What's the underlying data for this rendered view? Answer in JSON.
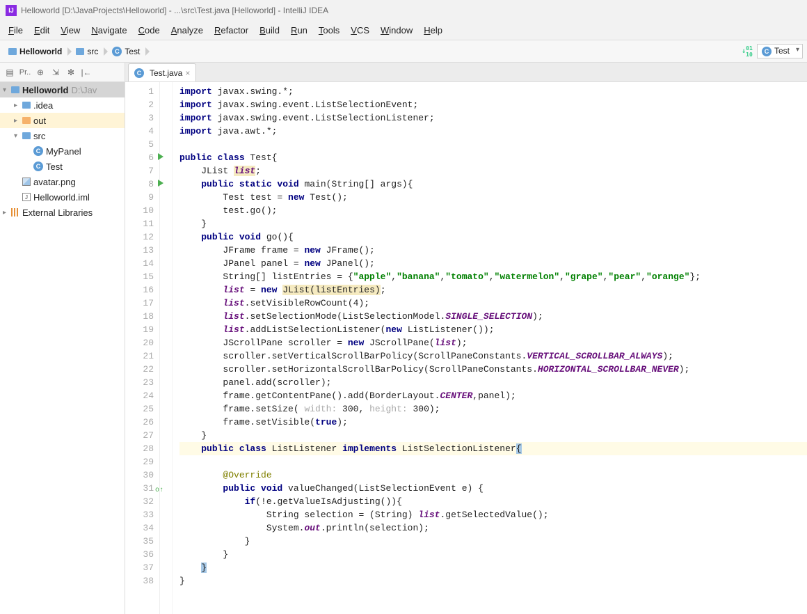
{
  "title": "Helloworld [D:\\JavaProjects\\Helloworld] - ...\\src\\Test.java [Helloworld] - IntelliJ IDEA",
  "menu": [
    "File",
    "Edit",
    "View",
    "Navigate",
    "Code",
    "Analyze",
    "Refactor",
    "Build",
    "Run",
    "Tools",
    "VCS",
    "Window",
    "Help"
  ],
  "breadcrumb": [
    {
      "icon": "folder",
      "label": "Helloworld",
      "bold": true
    },
    {
      "icon": "folder",
      "label": "src"
    },
    {
      "icon": "class",
      "label": "Test"
    }
  ],
  "run_config": "Test",
  "tab": {
    "label": "Test.java"
  },
  "tree": {
    "root": {
      "label": "Helloworld",
      "path": "D:\\JavaProjects\\Helloworld"
    },
    "children": [
      {
        "icon": "folder",
        "label": ".idea",
        "expandable": true
      },
      {
        "icon": "folder-orange",
        "label": "out",
        "expandable": true,
        "hl": true
      },
      {
        "icon": "folder",
        "label": "src",
        "expanded": true,
        "children": [
          {
            "icon": "class",
            "label": "MyPanel"
          },
          {
            "icon": "class",
            "label": "Test"
          }
        ]
      },
      {
        "icon": "image",
        "label": "avatar.png"
      },
      {
        "icon": "iml",
        "label": "Helloworld.iml"
      }
    ],
    "external": "External Libraries"
  },
  "code": {
    "lines": [
      {
        "n": 1,
        "html": "<span class='kw'>import</span> javax.swing.*;"
      },
      {
        "n": 2,
        "html": "<span class='kw'>import</span> javax.swing.event.ListSelectionEvent;"
      },
      {
        "n": 3,
        "html": "<span class='kw'>import</span> javax.swing.event.ListSelectionListener;"
      },
      {
        "n": 4,
        "html": "<span class='kw'>import</span> java.awt.*;"
      },
      {
        "n": 5,
        "html": ""
      },
      {
        "n": 6,
        "run": true,
        "html": "<span class='kw'>public class</span> Test{"
      },
      {
        "n": 7,
        "html": "    JList <span class='fld warn-bg'>list</span>;"
      },
      {
        "n": 8,
        "run": true,
        "html": "    <span class='kw'>public static void</span> main(String[] args){"
      },
      {
        "n": 9,
        "html": "        Test test = <span class='kw'>new</span> Test();"
      },
      {
        "n": 10,
        "html": "        test.go();"
      },
      {
        "n": 11,
        "html": "    }"
      },
      {
        "n": 12,
        "html": "    <span class='kw'>public void</span> go(){"
      },
      {
        "n": 13,
        "html": "        JFrame frame = <span class='kw'>new</span> JFrame();"
      },
      {
        "n": 14,
        "html": "        JPanel panel = <span class='kw'>new</span> JPanel();"
      },
      {
        "n": 15,
        "html": "        String[] listEntries = {<span class='str'>\"apple\"</span>,<span class='str'>\"banana\"</span>,<span class='str'>\"tomato\"</span>,<span class='str'>\"watermelon\"</span>,<span class='str'>\"grape\"</span>,<span class='str'>\"pear\"</span>,<span class='str'>\"orange\"</span>};"
      },
      {
        "n": 16,
        "html": "        <span class='fld'>list</span> = <span class='kw'>new</span> <span class='warn-bg'>JList(listEntries)</span>;"
      },
      {
        "n": 17,
        "html": "        <span class='fld'>list</span>.setVisibleRowCount(4);"
      },
      {
        "n": 18,
        "html": "        <span class='fld'>list</span>.setSelectionMode(ListSelectionModel.<span class='cnst'>SINGLE_SELECTION</span>);"
      },
      {
        "n": 19,
        "html": "        <span class='fld'>list</span>.addListSelectionListener(<span class='kw'>new</span> ListListener());"
      },
      {
        "n": 20,
        "html": "        JScrollPane scroller = <span class='kw'>new</span> JScrollPane(<span class='fld'>list</span>);"
      },
      {
        "n": 21,
        "html": "        scroller.setVerticalScrollBarPolicy(ScrollPaneConstants.<span class='cnst'>VERTICAL_SCROLLBAR_ALWAYS</span>);"
      },
      {
        "n": 22,
        "html": "        scroller.setHorizontalScrollBarPolicy(ScrollPaneConstants.<span class='cnst'>HORIZONTAL_SCROLLBAR_NEVER</span>);"
      },
      {
        "n": 23,
        "html": "        panel.add(scroller);"
      },
      {
        "n": 24,
        "html": "        frame.getContentPane().add(BorderLayout.<span class='cnst'>CENTER</span>,panel);"
      },
      {
        "n": 25,
        "html": "        frame.setSize( <span class='hint'>width:</span> 300, <span class='hint'>height:</span> 300);"
      },
      {
        "n": 26,
        "html": "        frame.setVisible(<span class='kw'>true</span>);"
      },
      {
        "n": 27,
        "html": "    }"
      },
      {
        "n": 28,
        "hl": true,
        "html": "    <span class='kw'>public class</span> ListListener <span class='kw'>implements</span> ListSelectionListener<span class='cursor-block'>{</span>"
      },
      {
        "n": 29,
        "html": ""
      },
      {
        "n": 30,
        "html": "        <span class='ann'>@Override</span>"
      },
      {
        "n": 31,
        "override": true,
        "html": "        <span class='kw'>public void</span> valueChanged(ListSelectionEvent e) {"
      },
      {
        "n": 32,
        "html": "            <span class='kw'>if</span>(!e.getValueIsAdjusting()){"
      },
      {
        "n": 33,
        "html": "                String selection = (String) <span class='fld'>list</span>.getSelectedValue();"
      },
      {
        "n": 34,
        "html": "                System.<span class='sfld'>out</span>.println(selection);"
      },
      {
        "n": 35,
        "html": "            }"
      },
      {
        "n": 36,
        "html": "        }"
      },
      {
        "n": 37,
        "html": "    <span class='cursor-block'>}</span>"
      },
      {
        "n": 38,
        "html": "}"
      }
    ]
  }
}
